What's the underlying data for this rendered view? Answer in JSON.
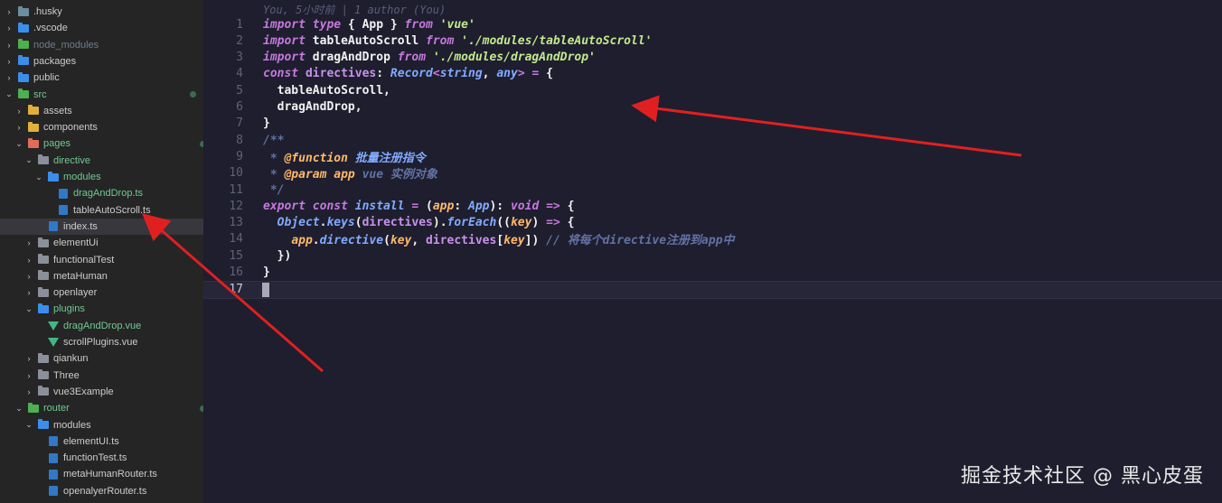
{
  "colors": {
    "keyword": "#c678dd",
    "import_kw": "#c792ea",
    "string": "#c3e88d",
    "type": "#82aaff",
    "param": "#ffb86c",
    "comment": "#6272a4",
    "function": "#82aaff",
    "arrow": "#e02020"
  },
  "sidebar": {
    "items": [
      {
        "label": ".husky",
        "icon": "folder-gear-icon",
        "depth": 0,
        "expanded": false
      },
      {
        "label": ".vscode",
        "icon": "folder-vscode-icon",
        "depth": 0,
        "expanded": false
      },
      {
        "label": "node_modules",
        "icon": "folder-green-icon",
        "depth": 0,
        "expanded": false
      },
      {
        "label": "packages",
        "icon": "folder-blue-icon",
        "depth": 0,
        "expanded": false
      },
      {
        "label": "public",
        "icon": "folder-blue-icon",
        "depth": 0,
        "expanded": false
      },
      {
        "label": "src",
        "icon": "folder-src-icon",
        "depth": 0,
        "expanded": true
      },
      {
        "label": "assets",
        "icon": "folder-yellow-icon",
        "depth": 1,
        "expanded": false
      },
      {
        "label": "components",
        "icon": "folder-yellow-icon",
        "depth": 1,
        "expanded": false
      },
      {
        "label": "pages",
        "icon": "folder-red-icon",
        "depth": 1,
        "expanded": true
      },
      {
        "label": "directive",
        "icon": "folder-icon",
        "depth": 2,
        "expanded": true
      },
      {
        "label": "modules",
        "icon": "folder-blue-icon",
        "depth": 3,
        "expanded": true
      },
      {
        "label": "dragAndDrop.ts",
        "icon": "typescript-file-icon",
        "depth": 4,
        "badge": "M"
      },
      {
        "label": "tableAutoScroll.ts",
        "icon": "typescript-file-icon",
        "depth": 4
      },
      {
        "label": "index.ts",
        "icon": "typescript-file-icon",
        "depth": 3
      },
      {
        "label": "elementUi",
        "icon": "folder-icon",
        "depth": 2,
        "expanded": false
      },
      {
        "label": "functionalTest",
        "icon": "folder-icon",
        "depth": 2,
        "expanded": false
      },
      {
        "label": "metaHuman",
        "icon": "folder-icon",
        "depth": 2,
        "expanded": false
      },
      {
        "label": "openlayer",
        "icon": "folder-icon",
        "depth": 2,
        "expanded": false
      },
      {
        "label": "plugins",
        "icon": "folder-blue-icon",
        "depth": 2,
        "expanded": true
      },
      {
        "label": "dragAndDrop.vue",
        "icon": "vue-file-icon",
        "depth": 3,
        "badge": "M"
      },
      {
        "label": "scrollPlugins.vue",
        "icon": "vue-file-icon",
        "depth": 3
      },
      {
        "label": "qiankun",
        "icon": "folder-icon",
        "depth": 2,
        "expanded": false
      },
      {
        "label": "Three",
        "icon": "folder-icon",
        "depth": 2,
        "expanded": false
      },
      {
        "label": "vue3Example",
        "icon": "folder-icon",
        "depth": 2,
        "expanded": false
      },
      {
        "label": "router",
        "icon": "folder-green-icon",
        "depth": 1,
        "expanded": true
      },
      {
        "label": "modules",
        "icon": "folder-blue-icon",
        "depth": 2,
        "expanded": true
      },
      {
        "label": "elementUI.ts",
        "icon": "typescript-file-icon",
        "depth": 3
      },
      {
        "label": "functionTest.ts",
        "icon": "typescript-file-icon",
        "depth": 3
      },
      {
        "label": "metaHumanRouter.ts",
        "icon": "typescript-file-icon",
        "depth": 3
      },
      {
        "label": "openalyerRouter.ts",
        "icon": "typescript-file-icon",
        "depth": 3
      }
    ]
  },
  "editor": {
    "blame": "You, 5小时前 | 1 author (You)",
    "lines": [
      {
        "n": "1",
        "tokens": [
          [
            "import type ",
            "kw"
          ],
          [
            "{ App } ",
            "plain"
          ],
          [
            "from ",
            "kw"
          ],
          [
            "'vue'",
            "str"
          ]
        ]
      },
      {
        "n": "2",
        "tokens": [
          [
            "import ",
            "kw"
          ],
          [
            "tableAutoScroll ",
            "plain"
          ],
          [
            "from ",
            "kw"
          ],
          [
            "'./modules/tableAutoScroll'",
            "str"
          ]
        ]
      },
      {
        "n": "3",
        "tokens": [
          [
            "import ",
            "kw"
          ],
          [
            "dragAndDrop ",
            "plain"
          ],
          [
            "from ",
            "kw"
          ],
          [
            "'./modules/dragAndDrop'",
            "str"
          ]
        ]
      },
      {
        "n": "4",
        "tokens": [
          [
            "const ",
            "kw"
          ],
          [
            "directives",
            "var"
          ],
          [
            ": ",
            "plain"
          ],
          [
            "Record",
            "type"
          ],
          [
            "<",
            "kw"
          ],
          [
            "string",
            "type"
          ],
          [
            ", ",
            "plain"
          ],
          [
            "any",
            "type"
          ],
          [
            "> = ",
            "kw"
          ],
          [
            "{",
            "plain"
          ]
        ]
      },
      {
        "n": "5",
        "tokens": [
          [
            "  tableAutoScroll,",
            "plain"
          ]
        ]
      },
      {
        "n": "6",
        "tokens": [
          [
            "  dragAndDrop,",
            "plain"
          ]
        ]
      },
      {
        "n": "7",
        "tokens": [
          [
            "}",
            "plain"
          ]
        ]
      },
      {
        "n": "8",
        "tokens": [
          [
            "/**",
            "cm"
          ]
        ]
      },
      {
        "n": "9",
        "tokens": [
          [
            " * ",
            "cm"
          ],
          [
            "@function ",
            "tag"
          ],
          [
            "批量注册指令",
            "type"
          ]
        ]
      },
      {
        "n": "10",
        "tokens": [
          [
            " * ",
            "cm"
          ],
          [
            "@param ",
            "tag"
          ],
          [
            "app ",
            "param"
          ],
          [
            "vue 实例对象",
            "cm"
          ]
        ]
      },
      {
        "n": "11",
        "tokens": [
          [
            " */",
            "cm"
          ]
        ]
      },
      {
        "n": "12",
        "tokens": [
          [
            "export const ",
            "kw"
          ],
          [
            "install ",
            "fn"
          ],
          [
            "= ",
            "kw"
          ],
          [
            "(",
            "plain"
          ],
          [
            "app",
            "param"
          ],
          [
            ": ",
            "plain"
          ],
          [
            "App",
            "type"
          ],
          [
            "): ",
            "plain"
          ],
          [
            "void ",
            "kw"
          ],
          [
            "=> ",
            "kw"
          ],
          [
            "{",
            "plain"
          ]
        ]
      },
      {
        "n": "13",
        "tokens": [
          [
            "  ",
            "plain"
          ],
          [
            "Object",
            "type"
          ],
          [
            ".",
            "plain"
          ],
          [
            "keys",
            "fn"
          ],
          [
            "(",
            "plain"
          ],
          [
            "directives",
            "var"
          ],
          [
            ").",
            "plain"
          ],
          [
            "forEach",
            "fn"
          ],
          [
            "((",
            "plain"
          ],
          [
            "key",
            "param"
          ],
          [
            ") ",
            "plain"
          ],
          [
            "=> ",
            "kw"
          ],
          [
            "{",
            "plain"
          ]
        ]
      },
      {
        "n": "14",
        "tokens": [
          [
            "    ",
            "plain"
          ],
          [
            "app",
            "param"
          ],
          [
            ".",
            "plain"
          ],
          [
            "directive",
            "fn"
          ],
          [
            "(",
            "plain"
          ],
          [
            "key",
            "param"
          ],
          [
            ", ",
            "plain"
          ],
          [
            "directives",
            "var"
          ],
          [
            "[",
            "plain"
          ],
          [
            "key",
            "param"
          ],
          [
            "]) ",
            "plain"
          ],
          [
            "// 将每个directive注册到app中",
            "cm"
          ]
        ]
      },
      {
        "n": "15",
        "tokens": [
          [
            "  })",
            "plain"
          ]
        ]
      },
      {
        "n": "16",
        "tokens": [
          [
            "}",
            "plain"
          ]
        ]
      },
      {
        "n": "17",
        "tokens": []
      }
    ]
  },
  "watermark": "掘金技术社区 @ 黑心皮蛋"
}
